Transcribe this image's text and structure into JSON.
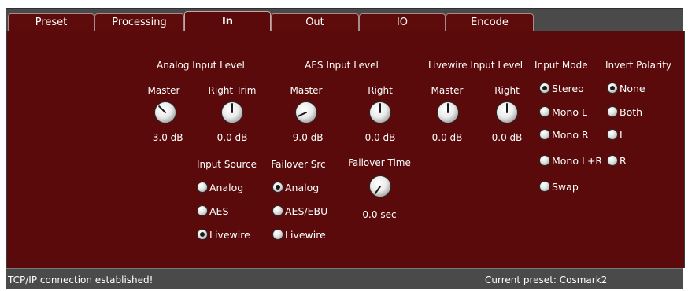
{
  "tabs": [
    {
      "label": "Preset"
    },
    {
      "label": "Processing"
    },
    {
      "label": "In",
      "active": true
    },
    {
      "label": "Out"
    },
    {
      "label": "IO"
    },
    {
      "label": "Encode"
    }
  ],
  "analog": {
    "title": "Analog Input Level",
    "master_label": "Master",
    "master_value": "-3.0 dB",
    "trim_label": "Right Trim",
    "trim_value": "0.0 dB"
  },
  "aes": {
    "title": "AES Input Level",
    "master_label": "Master",
    "master_value": "-9.0 dB",
    "right_label": "Right",
    "right_value": "0.0 dB"
  },
  "livewire": {
    "title": "Livewire Input Level",
    "master_label": "Master",
    "master_value": "0.0 dB",
    "right_label": "Right",
    "right_value": "0.0 dB"
  },
  "input_source": {
    "title": "Input Source",
    "options": [
      "Analog",
      "AES",
      "Livewire"
    ],
    "selected": "Livewire"
  },
  "failover_src": {
    "title": "Failover Src",
    "options": [
      "Analog",
      "AES/EBU",
      "Livewire"
    ],
    "selected": "Analog"
  },
  "failover_time": {
    "title": "Failover Time",
    "value": "0.0 sec"
  },
  "input_mode": {
    "title": "Input Mode",
    "options": [
      "Stereo",
      "Mono L",
      "Mono R",
      "Mono L+R",
      "Swap"
    ],
    "selected": "Stereo"
  },
  "invert_polarity": {
    "title": "Invert Polarity",
    "options": [
      "None",
      "Both",
      "L",
      "R"
    ],
    "selected": "None"
  },
  "status": {
    "message": "TCP/IP connection established!",
    "preset": "Current preset: Cosmark2"
  },
  "colors": {
    "panel": "#5a0a0a",
    "tab_bar": "#4a4a4a",
    "text": "#ffffff"
  }
}
